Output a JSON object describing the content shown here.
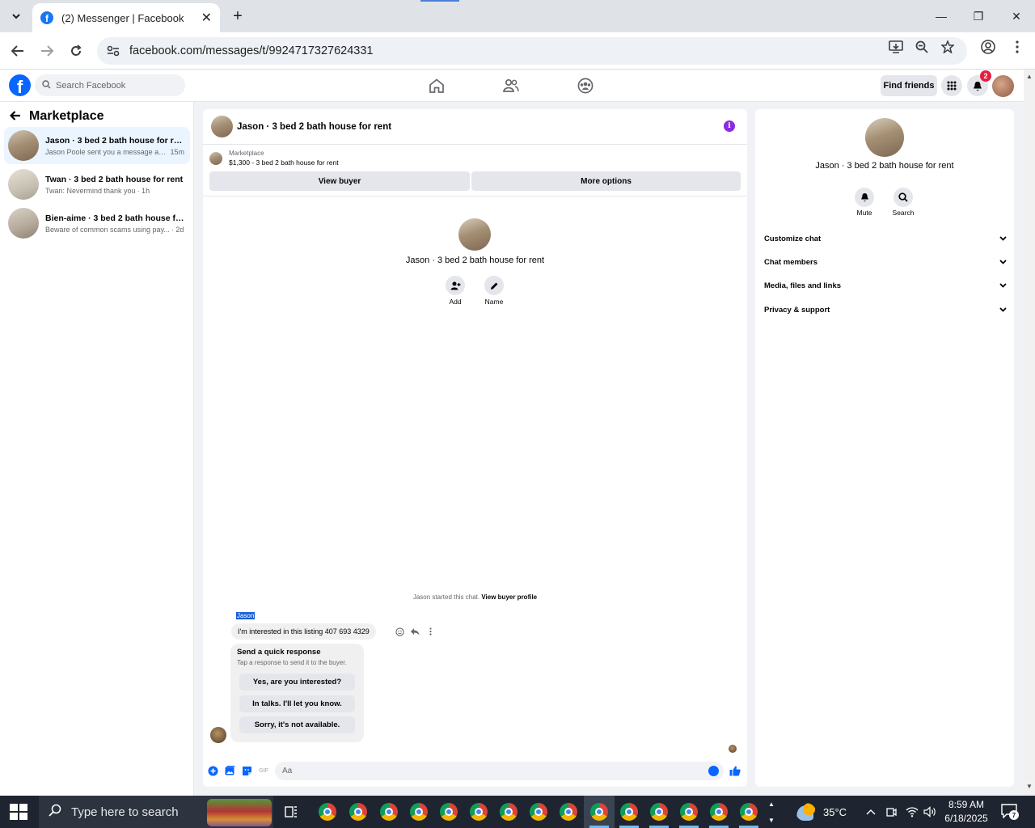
{
  "browser": {
    "tab_title": "(2) Messenger | Facebook",
    "url": "facebook.com/messages/t/9924717327624331",
    "close_glyph": "✕",
    "new_tab_glyph": "+",
    "minimize_glyph": "—",
    "restore_glyph": "❐",
    "window_close_glyph": "✕"
  },
  "fb_nav": {
    "search_placeholder": "Search Facebook",
    "find_friends": "Find friends",
    "notification_count": "2",
    "logo_letter": "f"
  },
  "left_panel": {
    "title": "Marketplace",
    "conversations": [
      {
        "name": "Jason · 3 bed 2 bath house for rent",
        "preview": "Jason Poole sent you a message ab...",
        "time": "15m",
        "active": true
      },
      {
        "name": "Twan · 3 bed 2 bath house for rent",
        "preview": "Twan: Nevermind thank you",
        "time": "· 1h",
        "active": false
      },
      {
        "name": "Bien-aime · 3 bed 2 bath house for...",
        "preview": "Beware of common scams using pay...",
        "time": "· 2d",
        "active": false
      }
    ]
  },
  "chat": {
    "header_title": "Jason · 3 bed 2 bath house for rent",
    "listing_category": "Marketplace",
    "listing_price_title": "$1,300 - 3 bed 2 bath house for rent",
    "view_buyer": "View buyer",
    "more_options": "More options",
    "center_title": "Jason · 3 bed 2 bath house for rent",
    "add_label": "Add",
    "name_label": "Name",
    "started_text": "Jason started this chat.",
    "view_buyer_profile": "View buyer profile",
    "sender_name": "Jason",
    "message": "I'm interested in this listing 407 693 4329",
    "quick_title": "Send a quick response",
    "quick_subtitle": "Tap a response to send it to the buyer.",
    "quick_responses": [
      "Yes, are you interested?",
      "In talks. I'll let you know.",
      "Sorry, it's not available."
    ],
    "composer_placeholder": "Aa",
    "gif_label": "GIF"
  },
  "right_panel": {
    "title": "Jason · 3 bed 2 bath house for rent",
    "mute": "Mute",
    "search": "Search",
    "sections": [
      "Customize chat",
      "Chat members",
      "Media, files and links",
      "Privacy & support"
    ]
  },
  "taskbar": {
    "search_placeholder": "Type here to search",
    "temperature": "35°C",
    "time": "8:59 AM",
    "date": "6/18/2025",
    "notification_count": "7"
  },
  "colors": {
    "facebook_blue": "#0866ff",
    "active_conversation": "#ebf5ff",
    "info_purple": "#8a2be2",
    "badge_red": "#e41e3f"
  }
}
